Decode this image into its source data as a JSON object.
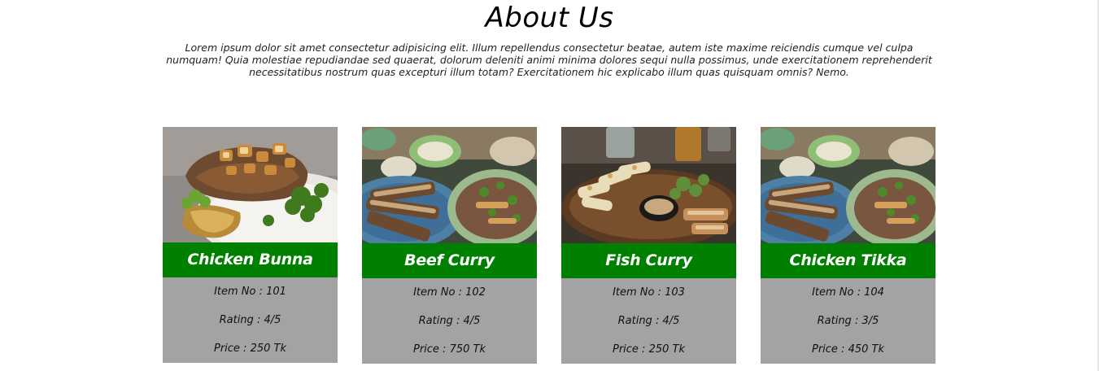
{
  "about": {
    "title": "About Us",
    "description": "Lorem ipsum dolor sit amet consectetur adipisicing elit. Illum repellendus consectetur beatae, autem iste maxime reiciendis cumque vel culpa numquam! Quia molestiae repudiandae sed quaerat, dolorum deleniti animi minima dolores sequi nulla possimus, unde exercitationem reprehenderit necessitatibus nostrum quas excepturi illum totam? Exercitationem hic explicabo illum quas quisquam omnis? Nemo."
  },
  "colors": {
    "card_title_bg": "#008000",
    "card_info_bg": "#a3a3a3"
  },
  "items": [
    {
      "name": "Chicken Bunna",
      "item_no": "Item No : 101",
      "rating": "Rating : 4/5",
      "price": "Price : 250 Tk",
      "photo": "grilled-chicken-photo"
    },
    {
      "name": "Beef Curry",
      "item_no": "Item No : 102",
      "rating": "Rating : 4/5",
      "price": "Price : 750 Tk",
      "photo": "bread-and-bowls-photo"
    },
    {
      "name": "Fish Curry",
      "item_no": "Item No : 103",
      "rating": "Rating : 4/5",
      "price": "Price : 250 Tk",
      "photo": "fish-platter-photo"
    },
    {
      "name": "Chicken Tikka",
      "item_no": "Item No : 104",
      "rating": "Rating : 3/5",
      "price": "Price : 450 Tk",
      "photo": "bread-and-bowls-photo"
    }
  ]
}
